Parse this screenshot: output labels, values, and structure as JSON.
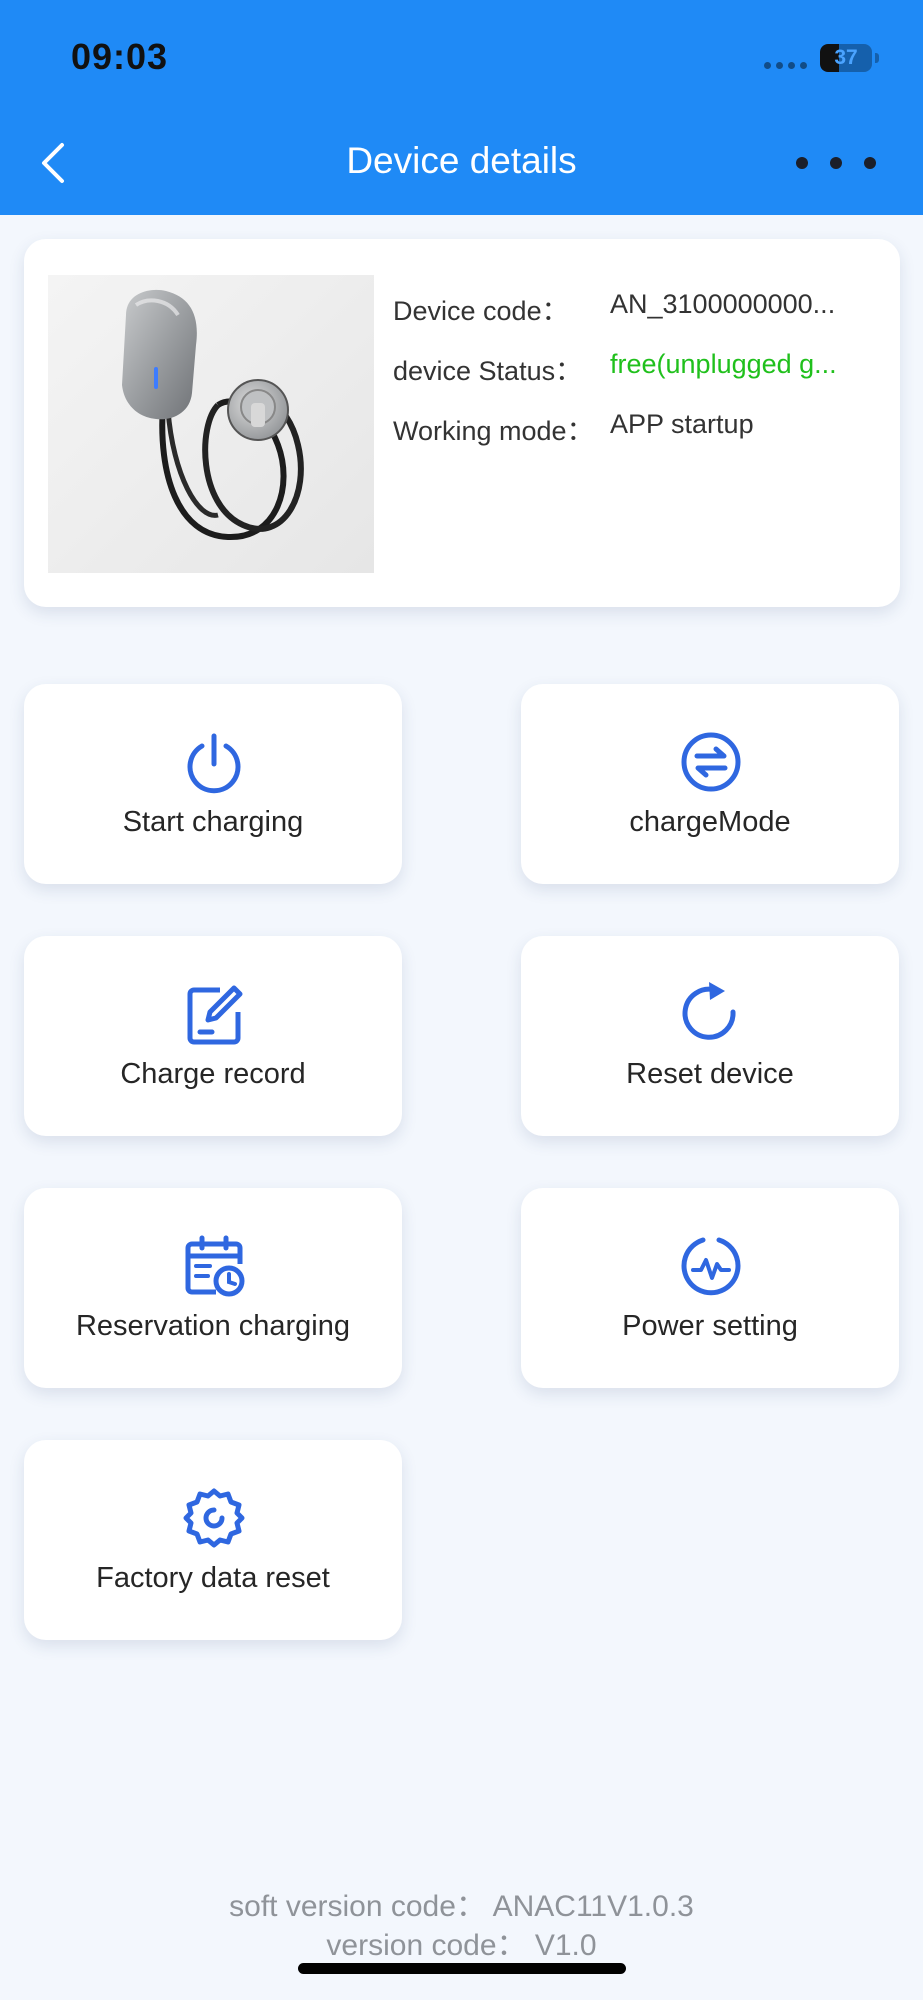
{
  "status_bar": {
    "time": "09:03",
    "battery": "37"
  },
  "header": {
    "title": "Device details",
    "back_icon": "chevron-left-icon",
    "more_icon": "more-horizontal-icon"
  },
  "device": {
    "code_label": "Device code：",
    "code_value": "AN_3100000000...",
    "status_label": "device Status：",
    "status_value": "free(unplugged g...",
    "mode_label": "Working mode：",
    "mode_value": "APP startup",
    "status_color": "#20c01c"
  },
  "actions": [
    {
      "label": "Start charging",
      "icon": "power-icon"
    },
    {
      "label": "chargeMode",
      "icon": "swap-arrows-icon"
    },
    {
      "label": "Charge record",
      "icon": "edit-note-icon"
    },
    {
      "label": "Reset device",
      "icon": "refresh-icon"
    },
    {
      "label": "Reservation charging",
      "icon": "calendar-clock-icon"
    },
    {
      "label": "Power setting",
      "icon": "pulse-gauge-icon"
    },
    {
      "label": "Factory data reset",
      "icon": "settings-gear-icon"
    }
  ],
  "footer": {
    "soft_version": "soft version code：  ANAC11V1.0.3",
    "version": "version code：  V1.0"
  },
  "colors": {
    "header": "#1f8af6",
    "accent_icon": "#2f67e0",
    "background": "#f3f7fd"
  }
}
